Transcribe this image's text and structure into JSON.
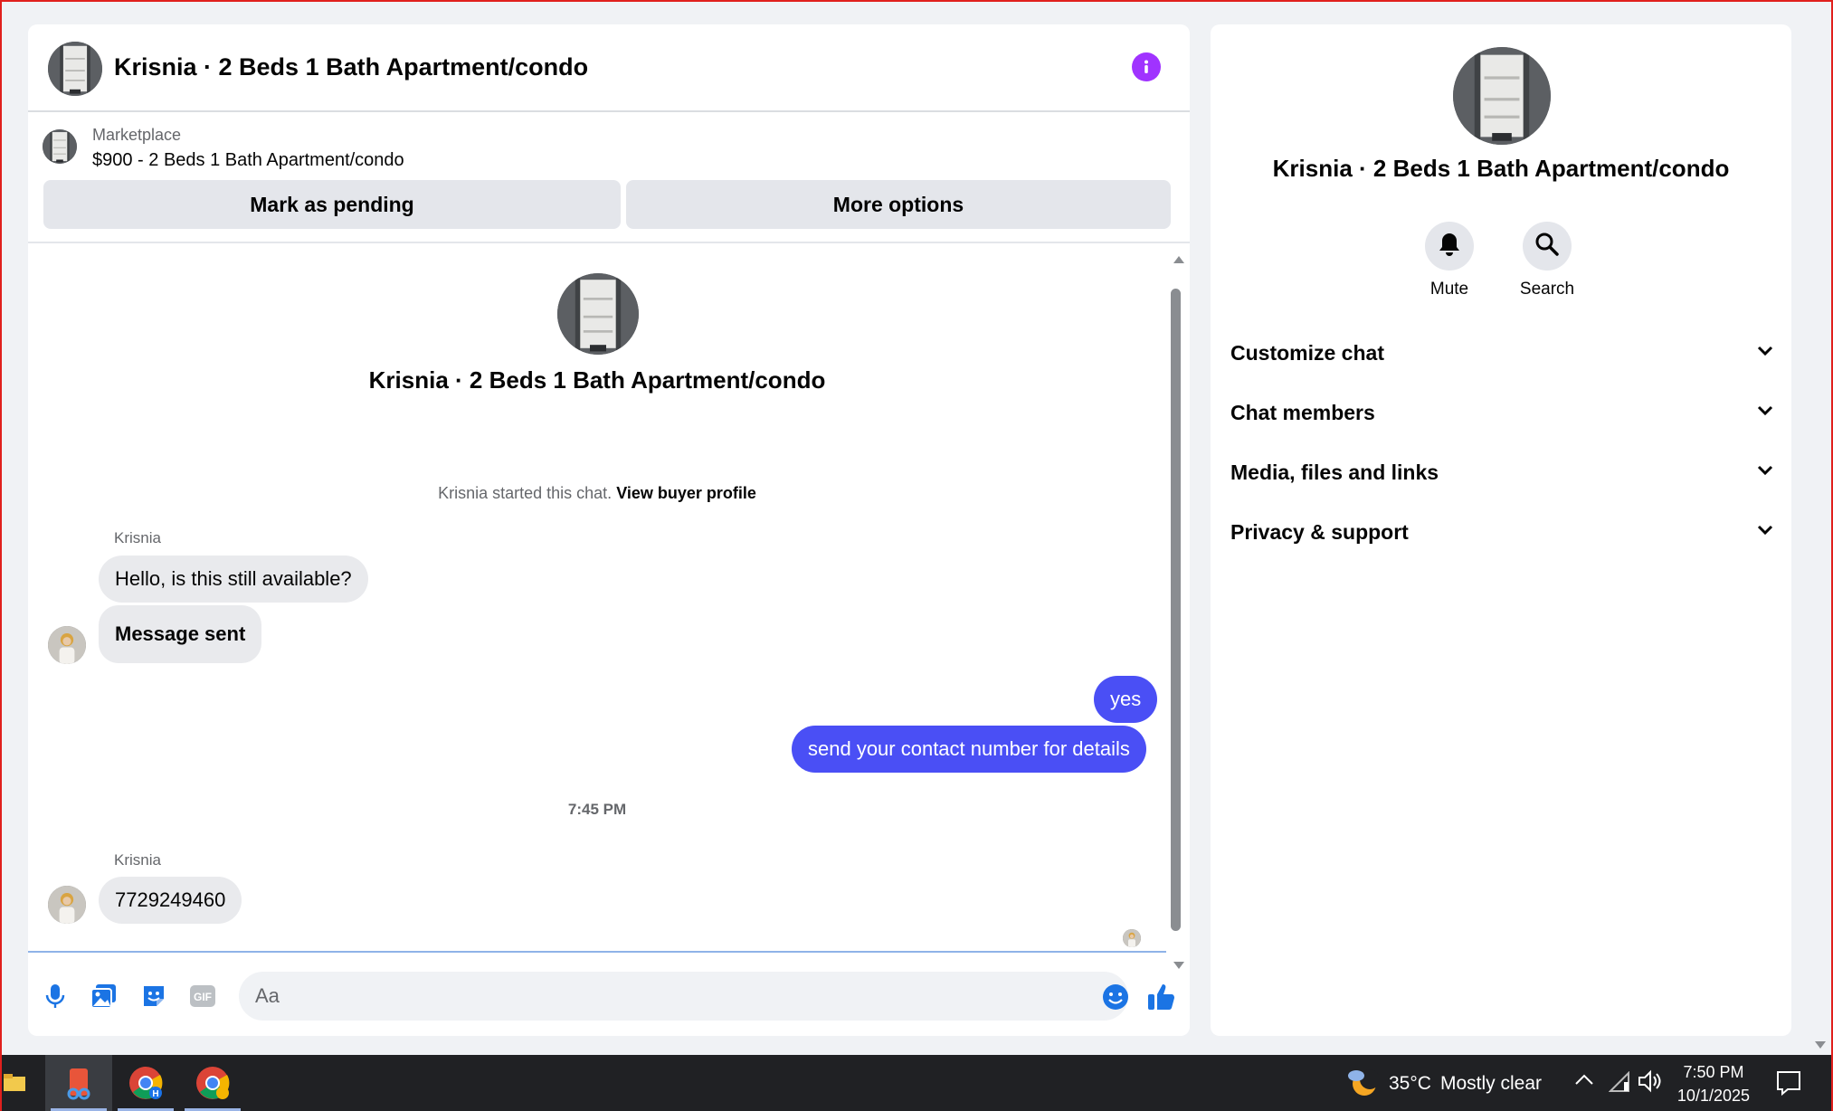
{
  "chat": {
    "title": "Krisnia · 2 Beds 1 Bath Apartment/condo",
    "marketplace_label": "Marketplace",
    "listing": "$900 - 2 Beds 1 Bath Apartment/condo",
    "mark_pending_label": "Mark as pending",
    "more_options_label": "More options",
    "intro_name": "Krisnia · 2 Beds 1 Bath Apartment/condo",
    "started_text": "Krisnia started this chat. ",
    "view_profile_link": "View buyer profile",
    "messages": [
      {
        "sender": "Krisnia",
        "text": "Hello, is this still available?"
      },
      {
        "text": "Message sent"
      },
      {
        "text": "yes"
      },
      {
        "text": "send your contact number for details"
      },
      {
        "sender": "Krisnia",
        "text": "7729249460"
      }
    ],
    "timestamp": "7:45 PM",
    "composer_placeholder": "Aa"
  },
  "panel": {
    "name": "Krisnia · 2 Beds 1 Bath Apartment/condo",
    "mute_label": "Mute",
    "search_label": "Search",
    "sections": [
      "Customize chat",
      "Chat members",
      "Media, files and links",
      "Privacy & support"
    ]
  },
  "taskbar": {
    "weather_temp": "35°C",
    "weather_desc": "Mostly clear",
    "time": "7:50 PM",
    "date": "10/1/2025"
  },
  "colors": {
    "accent": "#4a4ff5",
    "info_purple": "#a033ff",
    "like_blue": "#1b74e4"
  },
  "icons": [
    "info-icon",
    "microphone-icon",
    "image-icon",
    "sticker-icon",
    "gif-icon",
    "emoji-icon",
    "thumbs-up-icon",
    "bell-icon",
    "search-icon",
    "chevron-down-icon"
  ]
}
